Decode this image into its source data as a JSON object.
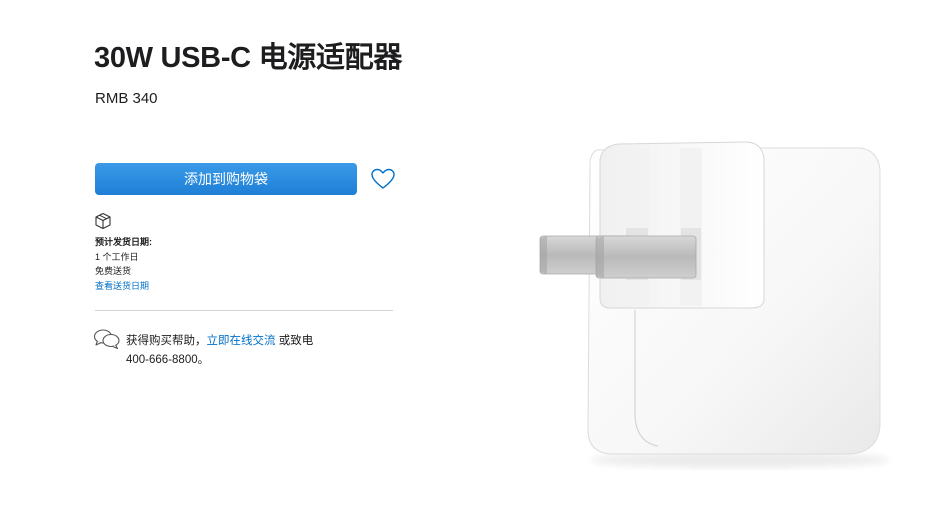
{
  "product": {
    "title": "30W USB-C 电源适配器",
    "price": "RMB 340"
  },
  "actions": {
    "add_to_bag_label": "添加到购物袋"
  },
  "shipping": {
    "label": "预计发货日期:",
    "days": "1 个工作日",
    "free_shipping": "免费送货",
    "link_label": "查看送货日期"
  },
  "help": {
    "prefix": "获得购买帮助，",
    "chat_link": "立即在线交流",
    "suffix": " 或致电",
    "phone": "400-666-8800。"
  },
  "colors": {
    "accent": "#0070c9",
    "button": "#2a8ce0",
    "text": "#1d1d1f"
  },
  "icons": {
    "favorite": "heart-icon",
    "shipping": "package-box-icon",
    "help": "chat-bubbles-icon"
  }
}
